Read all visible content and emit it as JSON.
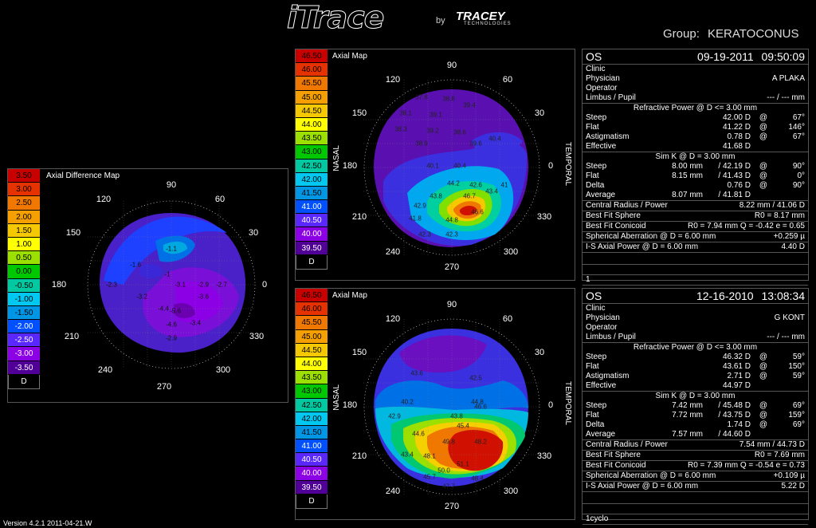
{
  "app": {
    "logo_text": "iTrace",
    "by_text": "by",
    "brand": "TRACEY",
    "brand_sub": "TECHNOLOGIES",
    "group_label": "Group:",
    "group_value": "KERATOCONUS",
    "version": "Version 4.2.1 2011-04-21.W"
  },
  "diff_map": {
    "title": "Axial Difference Map",
    "unit": "D",
    "scale": [
      {
        "label": "3.50",
        "color": "#c80000"
      },
      {
        "label": "3.00",
        "color": "#e63200"
      },
      {
        "label": "2.50",
        "color": "#f07800"
      },
      {
        "label": "2.00",
        "color": "#f5a000"
      },
      {
        "label": "1.50",
        "color": "#f5c800"
      },
      {
        "label": "1.00",
        "color": "#ffff00"
      },
      {
        "label": "0.50",
        "color": "#9be000"
      },
      {
        "label": "0.00",
        "color": "#00c800"
      },
      {
        "label": "-0.50",
        "color": "#00c8a0"
      },
      {
        "label": "-1.00",
        "color": "#00c8f0"
      },
      {
        "label": "-1.50",
        "color": "#0096e6"
      },
      {
        "label": "-2.00",
        "color": "#0050ff"
      },
      {
        "label": "-2.50",
        "color": "#5a28ff"
      },
      {
        "label": "-3.00",
        "color": "#8c00e6"
      },
      {
        "label": "-3.50",
        "color": "#500096"
      }
    ],
    "values": [
      "-1.1",
      "-1.6",
      "-2.3",
      "-3.1",
      "-2.9",
      "-2.7",
      "-1",
      "-4.4",
      "-5.6",
      "-3.6",
      "-4.6",
      "-3.4",
      "-2.9",
      "-3.2"
    ]
  },
  "axial_scale": [
    {
      "label": "46.50",
      "color": "#c80000"
    },
    {
      "label": "46.00",
      "color": "#e63200"
    },
    {
      "label": "45.50",
      "color": "#f07800"
    },
    {
      "label": "45.00",
      "color": "#f5a000"
    },
    {
      "label": "44.50",
      "color": "#f5c800"
    },
    {
      "label": "44.00",
      "color": "#ffff00"
    },
    {
      "label": "43.50",
      "color": "#9be000"
    },
    {
      "label": "43.00",
      "color": "#00c800"
    },
    {
      "label": "42.50",
      "color": "#00c8a0"
    },
    {
      "label": "42.00",
      "color": "#00c8f0"
    },
    {
      "label": "41.50",
      "color": "#0096e6"
    },
    {
      "label": "41.00",
      "color": "#0050ff"
    },
    {
      "label": "40.50",
      "color": "#5a28ff"
    },
    {
      "label": "40.00",
      "color": "#8c00e6"
    },
    {
      "label": "39.50",
      "color": "#500096"
    }
  ],
  "axial_unit": "D",
  "axes": {
    "d90": "90",
    "d120": "120",
    "d60": "60",
    "d150": "150",
    "d30": "30",
    "d180": "180",
    "d0": "0",
    "d210": "210",
    "d330": "330",
    "d240": "240",
    "d300": "300",
    "d270": "270"
  },
  "nasal": "NASAL",
  "temporal": "TEMPORAL",
  "map1": {
    "title": "Axial Map",
    "values": [
      "37.8",
      "38.8",
      "39.4",
      "38.1",
      "39.1",
      "38.3",
      "39.2",
      "38.6",
      "39.6",
      "40.4",
      "38.9",
      "40.1",
      "40.4",
      "44.2",
      "42.6",
      "43.8",
      "46.7",
      "43.4",
      "42.9",
      "46.6",
      "41.8",
      "44.8",
      "42.3",
      "42.3",
      "41"
    ]
  },
  "map2": {
    "title": "Axial Map",
    "values": [
      "43.6",
      "42.5",
      "40.2",
      "44.8",
      "42.9",
      "43.8",
      "45.4",
      "46.6",
      "44.6",
      "49.8",
      "48.2",
      "43.4",
      "48.1",
      "50.0",
      "51.1",
      "45.7",
      "47.7",
      "48.4"
    ]
  },
  "info1": {
    "eye": "OS",
    "date": "09-19-2011",
    "time": "09:50:09",
    "clinic_label": "Clinic",
    "physician_label": "Physician",
    "physician": "A PLAKA",
    "operator_label": "Operator",
    "limbus_label": "Limbus / Pupil",
    "limbus": "--- / --- mm",
    "refr_header": "Refractive Power @ D <= 3.00 mm",
    "steep_label": "Steep",
    "steep_val": "42.00 D",
    "steep_at": "@",
    "steep_axis": "67°",
    "flat_label": "Flat",
    "flat_val": "41.22 D",
    "flat_at": "@",
    "flat_axis": "146°",
    "astig_label": "Astigmatism",
    "astig_val": "0.78 D",
    "astig_at": "@",
    "astig_axis": "67°",
    "eff_label": "Effective",
    "eff_val": "41.68 D",
    "simk_header": "Sim K @ D = 3.00 mm",
    "sk_steep_label": "Steep",
    "sk_steep_mm": "8.00 mm",
    "sk_steep_d": "/ 42.19 D",
    "sk_steep_at": "@",
    "sk_steep_axis": "90°",
    "sk_flat_label": "Flat",
    "sk_flat_mm": "8.15 mm",
    "sk_flat_d": "/ 41.43 D",
    "sk_flat_at": "@",
    "sk_flat_axis": "0°",
    "sk_delta_label": "Delta",
    "sk_delta_d": "0.76 D",
    "sk_delta_at": "@",
    "sk_delta_axis": "90°",
    "sk_avg_label": "Average",
    "sk_avg_mm": "8.07 mm",
    "sk_avg_d": "/ 41.81 D",
    "cr_label": "Central Radius / Power",
    "cr_val": "8.22 mm  / 41.06 D",
    "bfs_label": "Best Fit Sphere",
    "bfs_val": "R0 = 8.17 mm",
    "bfc_label": "Best Fit Conicoid",
    "bfc_val": "R0 = 7.94 mm  Q = -0.42  e = 0.65",
    "sa_label": "Spherical Aberration @ D = 6.00 mm",
    "sa_val": "+0.259 µ",
    "is_label": "I-S Axial Power @ D = 6.00 mm",
    "is_val": "4.40 D",
    "footer": "1"
  },
  "info2": {
    "eye": "OS",
    "date": "12-16-2010",
    "time": "13:08:34",
    "clinic_label": "Clinic",
    "physician_label": "Physician",
    "physician": "G KONT",
    "operator_label": "Operator",
    "limbus_label": "Limbus / Pupil",
    "limbus": "--- / --- mm",
    "refr_header": "Refractive Power @ D <= 3.00 mm",
    "steep_label": "Steep",
    "steep_val": "46.32 D",
    "steep_at": "@",
    "steep_axis": "59°",
    "flat_label": "Flat",
    "flat_val": "43.61 D",
    "flat_at": "@",
    "flat_axis": "150°",
    "astig_label": "Astigmatism",
    "astig_val": "2.71 D",
    "astig_at": "@",
    "astig_axis": "59°",
    "eff_label": "Effective",
    "eff_val": "44.97 D",
    "simk_header": "Sim K @ D = 3.00 mm",
    "sk_steep_label": "Steep",
    "sk_steep_mm": "7.42 mm",
    "sk_steep_d": "/ 45.48 D",
    "sk_steep_at": "@",
    "sk_steep_axis": "69°",
    "sk_flat_label": "Flat",
    "sk_flat_mm": "7.72 mm",
    "sk_flat_d": "/ 43.75 D",
    "sk_flat_at": "@",
    "sk_flat_axis": "159°",
    "sk_delta_label": "Delta",
    "sk_delta_d": "1.74 D",
    "sk_delta_at": "@",
    "sk_delta_axis": "69°",
    "sk_avg_label": "Average",
    "sk_avg_mm": "7.57 mm",
    "sk_avg_d": "/ 44.60 D",
    "cr_label": "Central Radius / Power",
    "cr_val": "7.54 mm  / 44.73 D",
    "bfs_label": "Best Fit Sphere",
    "bfs_val": "R0 = 7.69 mm",
    "bfc_label": "Best Fit Conicoid",
    "bfc_val": "R0 = 7.39 mm  Q = -0.54  e = 0.73",
    "sa_label": "Spherical Aberration @ D = 6.00 mm",
    "sa_val": "+0.109 µ",
    "is_label": "I-S Axial Power @ D = 6.00 mm",
    "is_val": "5.22 D",
    "footer": "1cyclo"
  }
}
